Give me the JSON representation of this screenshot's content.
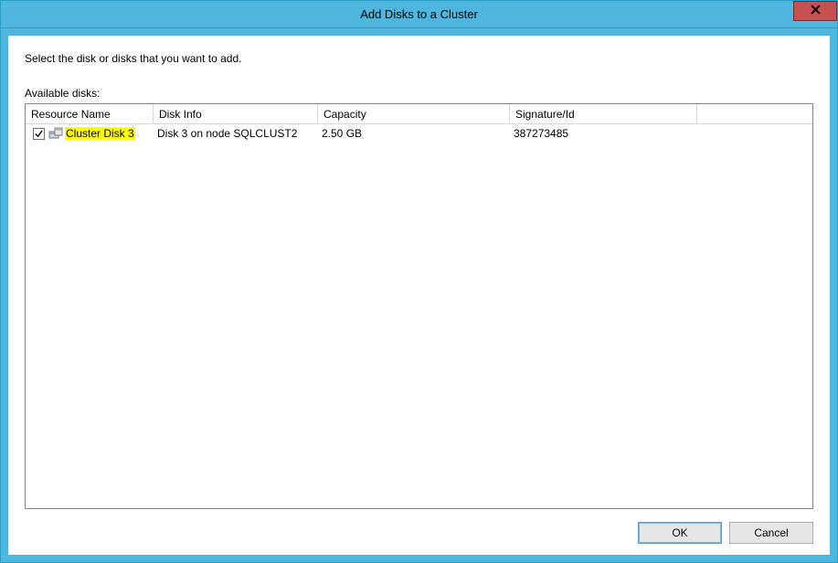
{
  "window": {
    "title": "Add Disks to a Cluster"
  },
  "instruction": "Select the disk or disks that you want to add.",
  "available_label": "Available disks:",
  "columns": {
    "resource": "Resource Name",
    "diskinfo": "Disk Info",
    "capacity": "Capacity",
    "signature": "Signature/Id"
  },
  "rows": [
    {
      "checked": true,
      "resource_name": "Cluster Disk 3",
      "disk_info": "Disk 3 on node SQLCLUST2",
      "capacity": "2.50 GB",
      "signature": "387273485"
    }
  ],
  "buttons": {
    "ok": "OK",
    "cancel": "Cancel"
  }
}
